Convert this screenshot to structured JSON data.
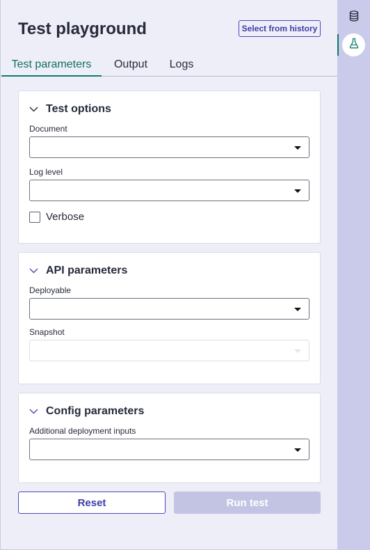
{
  "header": {
    "title": "Test playground",
    "history_button": "Select from history"
  },
  "tabs": [
    {
      "label": "Test parameters",
      "active": true
    },
    {
      "label": "Output",
      "active": false
    },
    {
      "label": "Logs",
      "active": false
    }
  ],
  "sections": {
    "test_options": {
      "title": "Test options",
      "fields": {
        "document": {
          "label": "Document",
          "value": ""
        },
        "log_level": {
          "label": "Log level",
          "value": ""
        }
      },
      "verbose": {
        "label": "Verbose",
        "checked": false
      }
    },
    "api_parameters": {
      "title": "API parameters",
      "fields": {
        "deployable": {
          "label": "Deployable",
          "value": ""
        },
        "snapshot": {
          "label": "Snapshot",
          "value": "",
          "disabled": true
        }
      }
    },
    "config_parameters": {
      "title": "Config parameters",
      "fields": {
        "additional_inputs": {
          "label": "Additional deployment inputs",
          "value": ""
        }
      }
    }
  },
  "actions": {
    "reset": "Reset",
    "run": "Run test",
    "run_disabled": true
  },
  "rail": {
    "items": [
      {
        "icon": "database-icon",
        "active": false
      },
      {
        "icon": "flask-icon",
        "active": true
      }
    ]
  },
  "colors": {
    "accent_teal": "#0f7a68",
    "primary_indigo": "#4a4ab8",
    "disabled_button": "#c3c4e4",
    "rail_background": "#cacbea",
    "page_background": "#eeeef8"
  }
}
